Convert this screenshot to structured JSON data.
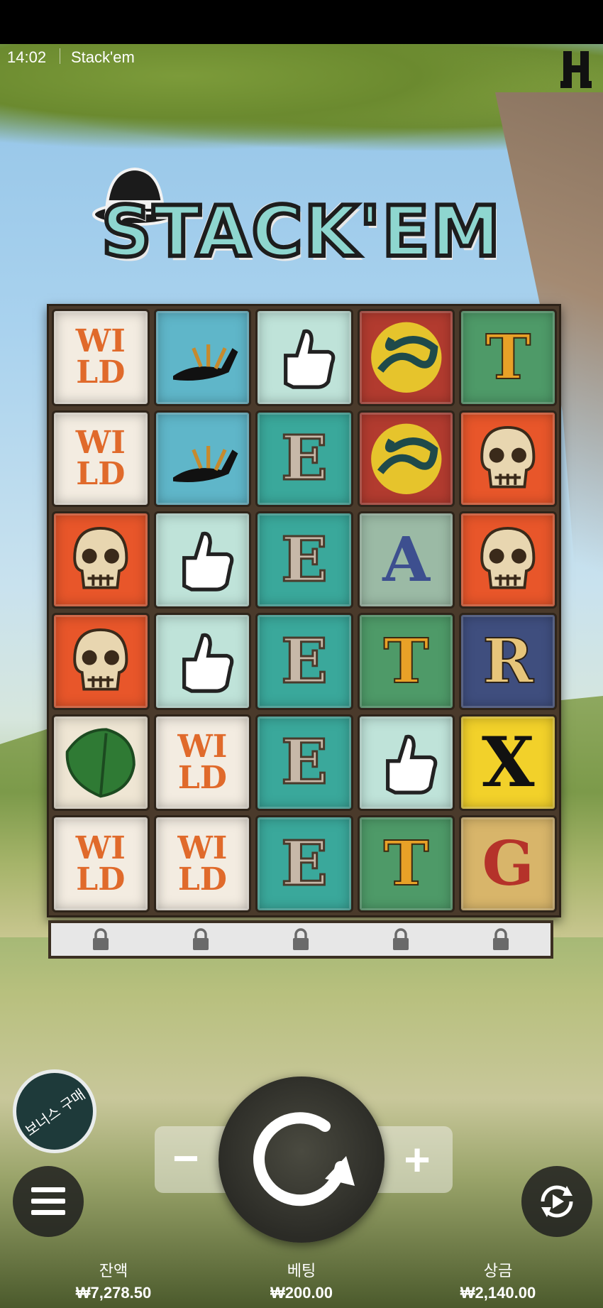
{
  "status_bar": {
    "time": "14:02",
    "app_name": "Stack'em"
  },
  "game": {
    "logo_text": "STACK'EM"
  },
  "grid": [
    [
      "WILD",
      "bird",
      "thumbs-up",
      "snake",
      "T"
    ],
    [
      "WILD",
      "bird",
      "E",
      "snake",
      "skull"
    ],
    [
      "skull",
      "thumbs-up",
      "E",
      "A",
      "skull"
    ],
    [
      "skull",
      "thumbs-up",
      "E",
      "T",
      "R"
    ],
    [
      "leaf",
      "WILD",
      "E",
      "thumbs-up",
      "X"
    ],
    [
      "WILD",
      "WILD",
      "E",
      "T",
      "G"
    ]
  ],
  "controls": {
    "bonus_buy_label": "보너스 구매",
    "minus": "−",
    "plus": "+"
  },
  "footer": {
    "balance_label": "잔액",
    "balance_value": "₩7,278.50",
    "bet_label": "베팅",
    "bet_value": "₩200.00",
    "win_label": "상금",
    "win_value": "₩2,140.00"
  }
}
